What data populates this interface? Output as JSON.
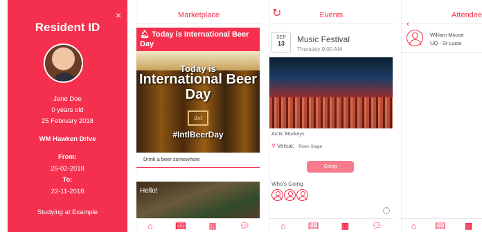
{
  "resident_id": {
    "close": "×",
    "title": "Resident ID",
    "name": "Jane Doe",
    "age": "0 years old",
    "birthdate": "25 February 2018",
    "address": "WM Hawken Drive",
    "from_label": "From:",
    "from_date": "25-02-2018",
    "to_label": "To:",
    "to_date": "22-11-2018",
    "study": "Studying at Example"
  },
  "marketplace": {
    "title": "Marketplace",
    "banner": "Today is International Beer Day",
    "image_text_line1": "Today is",
    "image_text_line2": "International Beer Day",
    "image_badge": "ibd",
    "image_hashtag": "#IntlBeerDay",
    "caption": "Drink a beer somewhere",
    "second_card_text": "Hello!"
  },
  "events": {
    "title": "Events",
    "month": "SEP",
    "day": "13",
    "event_title": "Music Festival",
    "event_time": "Thursday 9:00 AM",
    "artist": "Arctic Monkeys",
    "venue_label": "Venue:",
    "venue_value": "River Stage",
    "going_label": "Going",
    "whos_going_label": "Who's Going"
  },
  "attendees": {
    "title": "Attendees",
    "person_name": "William Mouse",
    "person_location": "UQ - St Lucia"
  },
  "icons": {
    "close": "close-icon",
    "refresh": "refresh-icon",
    "back": "chevron-left-icon",
    "bell": "bell-icon",
    "pin": "location-pin-icon",
    "home": "home-icon",
    "book": "book-icon",
    "calendar": "calendar-icon",
    "chat": "chat-icon"
  },
  "colors": {
    "accent": "#f5304e",
    "button": "#f87b8e"
  }
}
